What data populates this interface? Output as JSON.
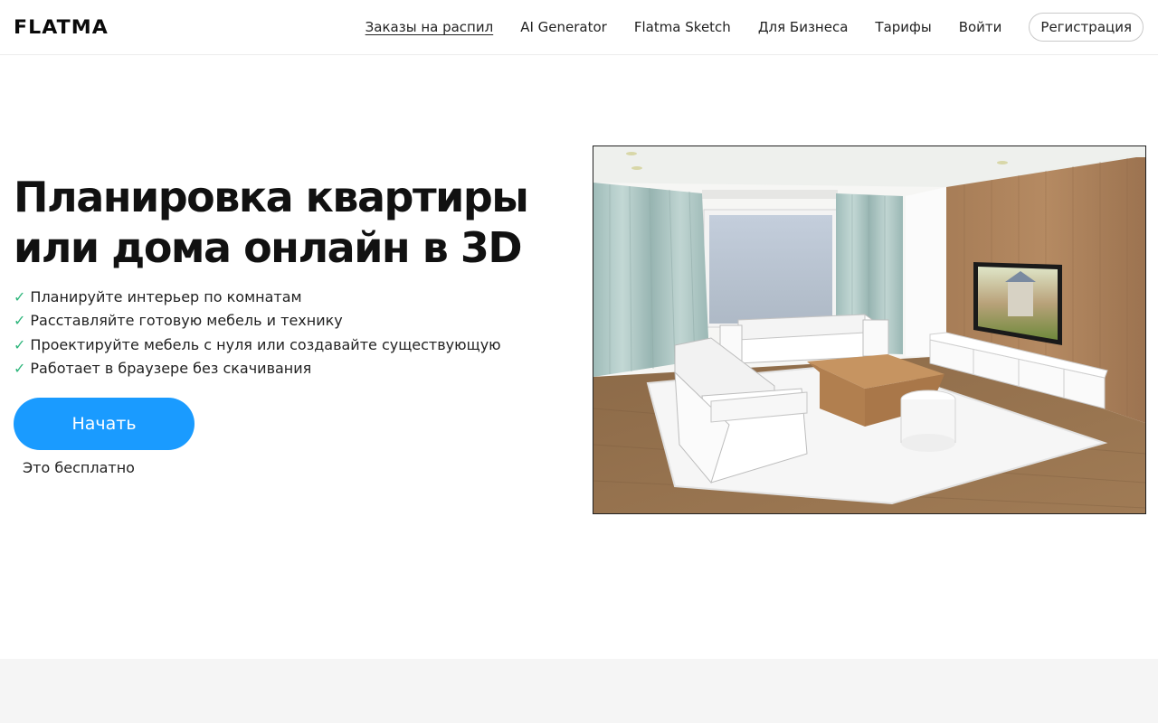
{
  "header": {
    "logo": "FLATMA",
    "nav": [
      {
        "label": "Заказы на распил",
        "active": true
      },
      {
        "label": "AI Generator"
      },
      {
        "label": "Flatma Sketch"
      },
      {
        "label": "Для Бизнеса"
      },
      {
        "label": "Тарифы"
      },
      {
        "label": "Войти"
      }
    ],
    "register_label": "Регистрация"
  },
  "hero": {
    "title_line1": "Планировка квартиры",
    "title_line2": "или дома онлайн в 3D",
    "check_icon": "✓",
    "features": [
      "Планируйте интерьер по комнатам",
      "Расставляйте готовую мебель и технику",
      "Проектируйте мебель с нуля или создавайте существующую",
      "Работает в браузере без скачивания"
    ],
    "cta_label": "Начать",
    "cta_note": "Это бесплатно"
  },
  "colors": {
    "accent": "#1a9bff",
    "check": "#2fb67c",
    "footer_band": "#f5f5f5"
  }
}
